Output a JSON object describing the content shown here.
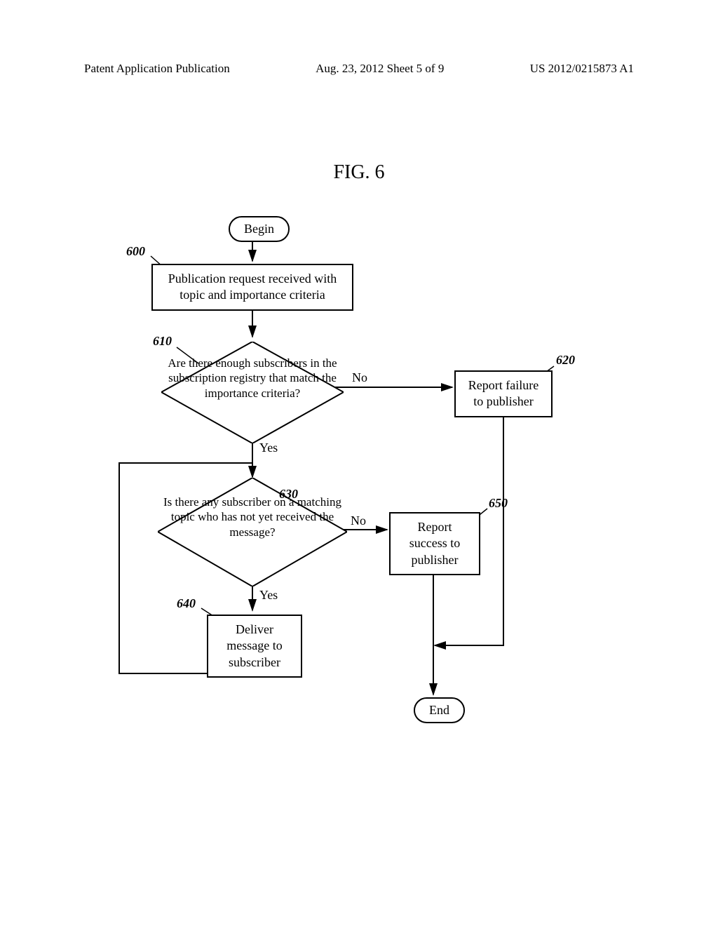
{
  "header": {
    "left": "Patent Application Publication",
    "middle": "Aug. 23, 2012  Sheet 5 of 9",
    "right": "US 2012/0215873 A1"
  },
  "figure_title": "FIG. 6",
  "nodes": {
    "begin": "Begin",
    "end": "End",
    "n600": "Publication request received with topic and importance criteria",
    "n610": "Are there enough subscribers in the subscription registry that match the importance criteria?",
    "n620": "Report failure to publisher",
    "n630": "Is there any subscriber on a matching topic who has not yet received the message?",
    "n640": "Deliver message to subscriber",
    "n650": "Report success to publisher"
  },
  "refs": {
    "r600": "600",
    "r610": "610",
    "r620": "620",
    "r630": "630",
    "r640": "640",
    "r650": "650"
  },
  "labels": {
    "yes": "Yes",
    "no": "No"
  }
}
